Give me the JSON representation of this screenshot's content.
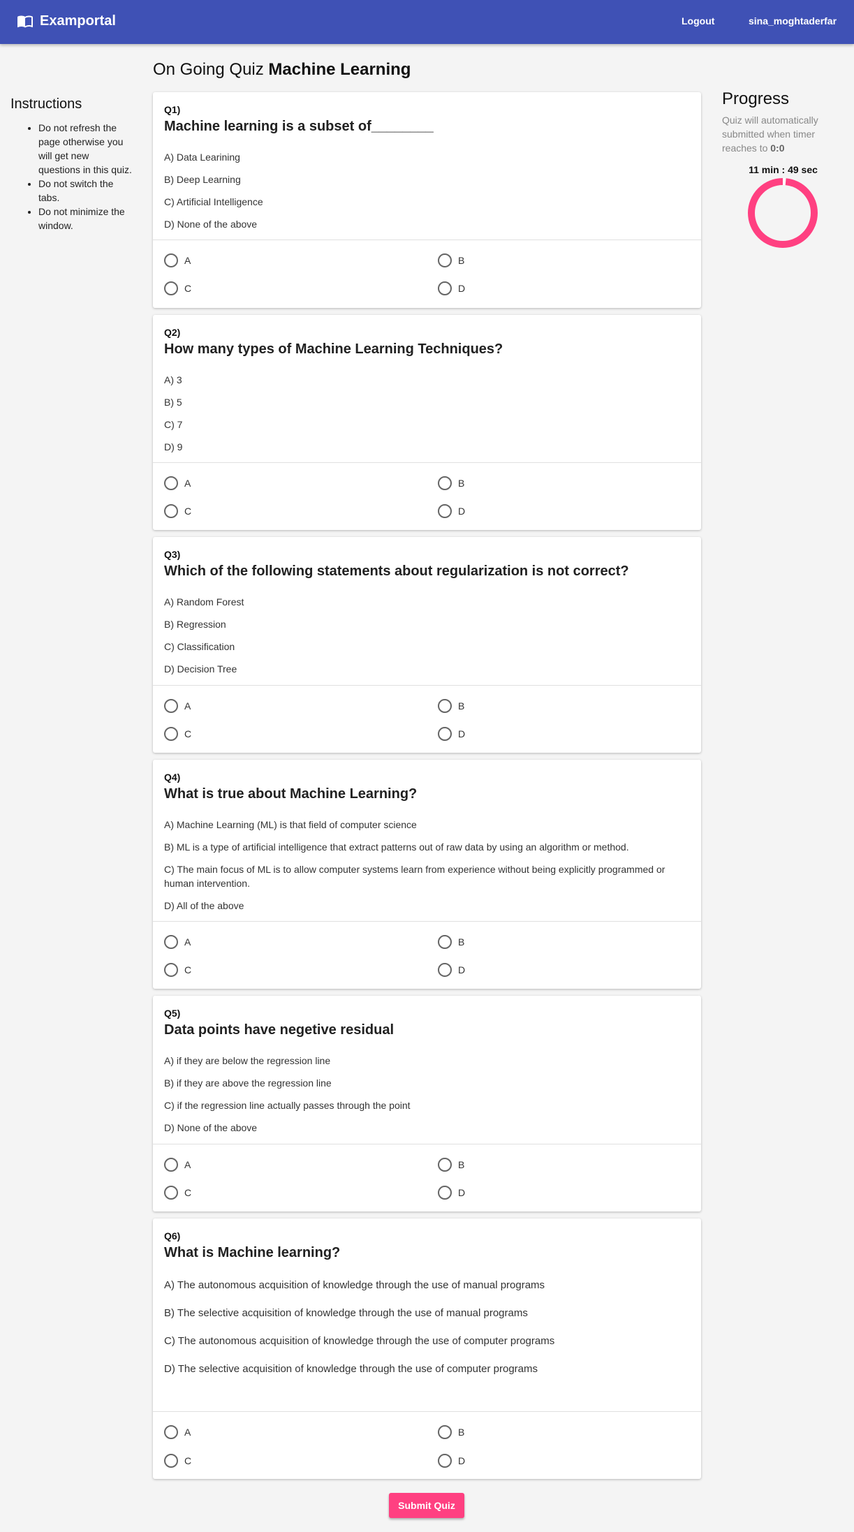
{
  "app": {
    "name": "Examportal"
  },
  "nav": {
    "logout": "Logout",
    "user": "sina_moghtaderfar"
  },
  "sidebar": {
    "title": "Instructions",
    "items": [
      "Do not refresh the page otherwise you will get new questions in this quiz.",
      "Do not switch the tabs.",
      "Do not minimize the window."
    ]
  },
  "quiz": {
    "prefix": "On Going Quiz",
    "name": "Machine Learning"
  },
  "questions": [
    {
      "num": "Q1)",
      "text": "Machine learning is a subset of________",
      "options": [
        "A) Data Learining",
        "B) Deep Learning",
        "C) Artificial Intelligence",
        "D) None of the above"
      ],
      "choices": [
        "A",
        "B",
        "C",
        "D"
      ]
    },
    {
      "num": "Q2)",
      "text": "How many types of Machine Learning Techniques?",
      "options": [
        "A) 3",
        "B) 5",
        "C) 7",
        "D) 9"
      ],
      "choices": [
        "A",
        "B",
        "C",
        "D"
      ]
    },
    {
      "num": "Q3)",
      "text": "Which of the following statements about regularization is not correct?",
      "options": [
        "A) Random Forest",
        "B) Regression",
        "C) Classification",
        "D) Decision Tree"
      ],
      "choices": [
        "A",
        "B",
        "C",
        "D"
      ]
    },
    {
      "num": "Q4)",
      "text": "What is true about Machine Learning?",
      "options": [
        "A) Machine Learning (ML) is that field of computer science",
        "B) ML is a type of artificial intelligence that extract patterns out of raw data by using an algorithm or method.",
        "C) The main focus of ML is to allow computer systems learn from experience without being explicitly programmed or human intervention.",
        "D) All of the above"
      ],
      "choices": [
        "A",
        "B",
        "C",
        "D"
      ]
    },
    {
      "num": "Q5)",
      "text": "Data points have negetive residual",
      "options": [
        "A) if they are below the regression line",
        "B) if they are above the regression line",
        "C) if the regression line actually passes through the point",
        "D) None of the above"
      ],
      "choices": [
        "A",
        "B",
        "C",
        "D"
      ]
    },
    {
      "num": "Q6)",
      "text": "What is Machine learning?",
      "options": [
        "A) The autonomous acquisition of knowledge through the use of manual programs",
        "B) The selective acquisition of knowledge through the use of manual programs",
        "C) The autonomous acquisition of knowledge through the use of computer programs",
        "D) The selective acquisition of knowledge through the use of computer programs"
      ],
      "choices": [
        "A",
        "B",
        "C",
        "D"
      ]
    }
  ],
  "progress": {
    "title": "Progress",
    "note": "Quiz will automatically submitted when timer reaches to",
    "note_value": "0:0",
    "timer": "11 min : 49 sec",
    "remaining_fraction": 0.985,
    "ring_color": "#ff4081"
  },
  "submit": {
    "label": "Submit Quiz"
  }
}
